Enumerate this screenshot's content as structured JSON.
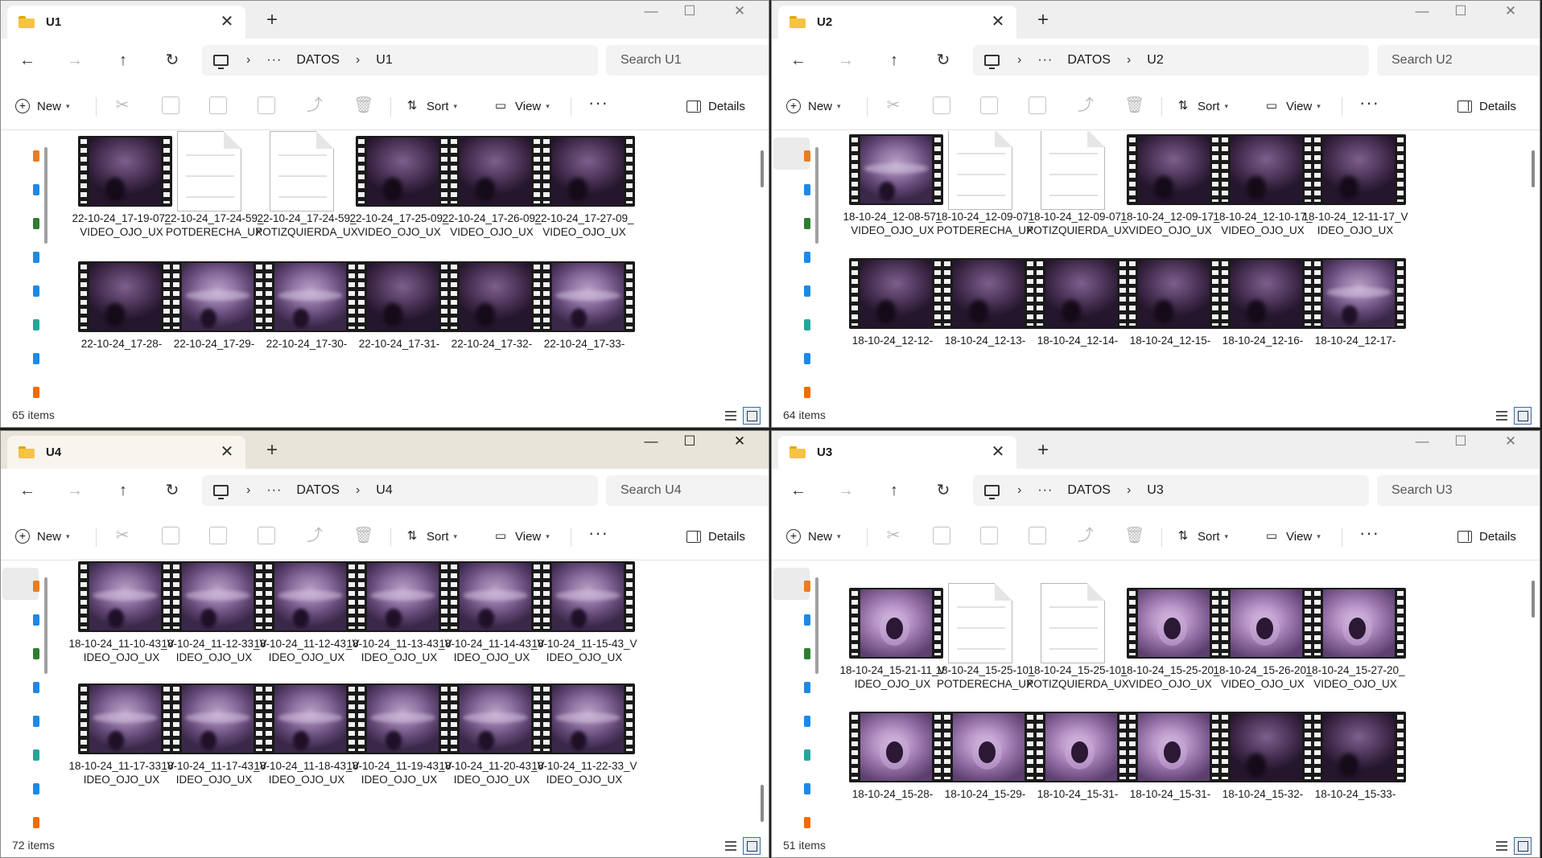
{
  "common": {
    "new_label": "New",
    "sort_label": "Sort",
    "view_label": "View",
    "details_label": "Details",
    "root_folder": "DATOS",
    "more_label": "···",
    "ellipsis": "···"
  },
  "windows": [
    {
      "tab_title": "U1",
      "folder": "U1",
      "search_placeholder": "Search U1",
      "status": "65 items",
      "rows": [
        [
          {
            "kind": "video",
            "style": "dark",
            "name": "22-10-24_17-19-07_VIDEO_OJO_UX"
          },
          {
            "kind": "doc",
            "name": "22-10-24_17-24-59_POTDERECHA_UX"
          },
          {
            "kind": "doc",
            "name": "22-10-24_17-24-59_POTIZQUIERDA_UX"
          },
          {
            "kind": "video",
            "style": "dark",
            "name": "22-10-24_17-25-09_VIDEO_OJO_UX"
          },
          {
            "kind": "video",
            "style": "dark",
            "name": "22-10-24_17-26-09_VIDEO_OJO_UX"
          },
          {
            "kind": "video",
            "style": "dark",
            "name": "22-10-24_17-27-09_VIDEO_OJO_UX"
          }
        ],
        [
          {
            "kind": "video",
            "style": "dark",
            "name": "22-10-24_17-28-"
          },
          {
            "kind": "video",
            "style": "band",
            "name": "22-10-24_17-29-"
          },
          {
            "kind": "video",
            "style": "band",
            "name": "22-10-24_17-30-"
          },
          {
            "kind": "video",
            "style": "dark",
            "name": "22-10-24_17-31-"
          },
          {
            "kind": "video",
            "style": "dark",
            "name": "22-10-24_17-32-"
          },
          {
            "kind": "video",
            "style": "band",
            "name": "22-10-24_17-33-"
          }
        ]
      ]
    },
    {
      "tab_title": "U2",
      "folder": "U2",
      "search_placeholder": "Search U2",
      "status": "64 items",
      "rows": [
        [
          {
            "kind": "video",
            "style": "band",
            "name": "18-10-24_12-08-57_VIDEO_OJO_UX"
          },
          {
            "kind": "doc",
            "name": "18-10-24_12-09-07_POTDERECHA_UX"
          },
          {
            "kind": "doc",
            "name": "18-10-24_12-09-07_POTIZQUIERDA_UX"
          },
          {
            "kind": "video",
            "style": "dark",
            "name": "18-10-24_12-09-17_VIDEO_OJO_UX"
          },
          {
            "kind": "video",
            "style": "dark",
            "name": "18-10-24_12-10-17_VIDEO_OJO_UX"
          },
          {
            "kind": "video",
            "style": "dark",
            "name": "18-10-24_12-11-17_VIDEO_OJO_UX"
          }
        ],
        [
          {
            "kind": "video",
            "style": "dark",
            "name": "18-10-24_12-12-"
          },
          {
            "kind": "video",
            "style": "dark",
            "name": "18-10-24_12-13-"
          },
          {
            "kind": "video",
            "style": "dark",
            "name": "18-10-24_12-14-"
          },
          {
            "kind": "video",
            "style": "dark",
            "name": "18-10-24_12-15-"
          },
          {
            "kind": "video",
            "style": "dark",
            "name": "18-10-24_12-16-"
          },
          {
            "kind": "video",
            "style": "band",
            "name": "18-10-24_12-17-"
          }
        ]
      ]
    },
    {
      "tab_title": "U4",
      "folder": "U4",
      "search_placeholder": "Search U4",
      "status": "72 items",
      "rows": [
        [
          {
            "kind": "video",
            "style": "band",
            "name": "18-10-24_11-10-43_VIDEO_OJO_UX"
          },
          {
            "kind": "video",
            "style": "band",
            "name": "18-10-24_11-12-33_VIDEO_OJO_UX"
          },
          {
            "kind": "video",
            "style": "band",
            "name": "18-10-24_11-12-43_VIDEO_OJO_UX"
          },
          {
            "kind": "video",
            "style": "band",
            "name": "18-10-24_11-13-43_VIDEO_OJO_UX"
          },
          {
            "kind": "video",
            "style": "band",
            "name": "18-10-24_11-14-43_VIDEO_OJO_UX"
          },
          {
            "kind": "video",
            "style": "band",
            "name": "18-10-24_11-15-43_VIDEO_OJO_UX"
          }
        ],
        [
          {
            "kind": "video",
            "style": "band",
            "name": "18-10-24_11-17-33_VIDEO_OJO_UX"
          },
          {
            "kind": "video",
            "style": "band",
            "name": "18-10-24_11-17-43_VIDEO_OJO_UX"
          },
          {
            "kind": "video",
            "style": "band",
            "name": "18-10-24_11-18-43_VIDEO_OJO_UX"
          },
          {
            "kind": "video",
            "style": "band",
            "name": "18-10-24_11-19-43_VIDEO_OJO_UX"
          },
          {
            "kind": "video",
            "style": "band",
            "name": "18-10-24_11-20-43_VIDEO_OJO_UX"
          },
          {
            "kind": "video",
            "style": "band",
            "name": "18-10-24_11-22-33_VIDEO_OJO_UX"
          }
        ]
      ]
    },
    {
      "tab_title": "U3",
      "folder": "U3",
      "search_placeholder": "Search U3",
      "status": "51 items",
      "rows": [
        [
          {
            "kind": "video",
            "style": "light",
            "name": "18-10-24_15-21-11_VIDEO_OJO_UX"
          },
          {
            "kind": "doc",
            "name": "18-10-24_15-25-10_POTDERECHA_UX"
          },
          {
            "kind": "doc",
            "name": "18-10-24_15-25-10_POTIZQUIERDA_UX"
          },
          {
            "kind": "video",
            "style": "light",
            "name": "18-10-24_15-25-20_VIDEO_OJO_UX"
          },
          {
            "kind": "video",
            "style": "light",
            "name": "18-10-24_15-26-20_VIDEO_OJO_UX"
          },
          {
            "kind": "video",
            "style": "light",
            "name": "18-10-24_15-27-20_VIDEO_OJO_UX"
          }
        ],
        [
          {
            "kind": "video",
            "style": "light",
            "name": "18-10-24_15-28-"
          },
          {
            "kind": "video",
            "style": "light",
            "name": "18-10-24_15-29-"
          },
          {
            "kind": "video",
            "style": "light",
            "name": "18-10-24_15-31-"
          },
          {
            "kind": "video",
            "style": "light",
            "name": "18-10-24_15-31-"
          },
          {
            "kind": "video",
            "style": "dark",
            "name": "18-10-24_15-32-"
          },
          {
            "kind": "video",
            "style": "dark",
            "name": "18-10-24_15-33-"
          }
        ]
      ]
    }
  ],
  "icons": {
    "back": "arrow-left-icon",
    "forward": "arrow-right-icon",
    "up": "arrow-up-icon",
    "refresh": "refresh-icon",
    "computer": "computer-icon",
    "folder": "folder-icon",
    "cut": "cut-icon",
    "copy": "copy-icon",
    "paste": "paste-icon",
    "rename": "rename-icon",
    "share": "share-icon",
    "delete": "delete-icon",
    "video": "video-file-icon",
    "document": "document-file-icon"
  },
  "colors": {
    "folder_yellow": "#f6c343",
    "active_titlebar": "#e9e4da",
    "thumbnail_purple": "#7d5f8c"
  }
}
